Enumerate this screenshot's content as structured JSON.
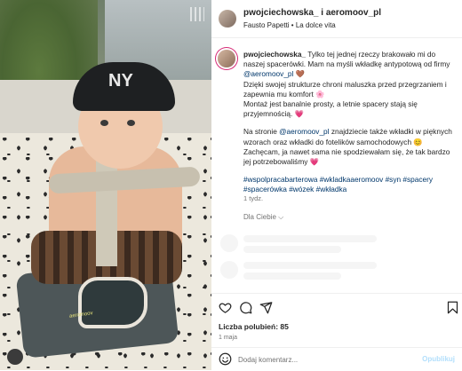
{
  "post": {
    "header": {
      "username": "pwojciechowska_ i aeromoov_pl",
      "music": "Fausto Papetti • La dolce vita"
    },
    "photo": {
      "cap_logo": "NY",
      "mat_label": "aeromoov"
    },
    "caption": {
      "username": "pwojciechowska_",
      "line1": " Tylko tej jednej rzeczy brakowało mi do naszej spacerówki. Mam na myśli wkładkę antypotową od firmy ",
      "mention1": "@aeromoov_pl",
      "emoji1": " 🤎",
      "line2": "Dzięki swojej strukturze chroni maluszka przed przegrzaniem i zapewnia mu komfort 🌸",
      "line3": "Montaż jest banalnie prosty, a letnie spacery stają się przyjemnością. 💗",
      "line4a": "Na stronie ",
      "mention2": "@aeromoov_pl",
      "line4b": " znajdziecie także wkładki w pięknych wzorach oraz wkładki do fotelików samochodowych 😊",
      "line5": "Zachęcam, ja nawet sama nie spodziewałam się, że tak bardzo jej potrzebowaliśmy 💗",
      "hashtags": "#wspolpracabarterowa #wkladkaaeromoov #syn #spacery #spacerówka #wózek #wkładka",
      "time": "1 tydz.",
      "translate": "Dla Ciebie ⌵"
    },
    "likes": "Liczba polubień: 85",
    "date": "1 maja",
    "comment": {
      "placeholder": "Dodaj komentarz...",
      "publish": "Opublikuj"
    }
  },
  "icons": [
    "heart-icon",
    "comment-icon",
    "share-icon",
    "bookmark-icon",
    "emoji-icon"
  ],
  "colors": {
    "link": "#00376b",
    "muted": "#737373",
    "publish_disabled": "#b2dffc",
    "story_ring": "#d62976"
  }
}
